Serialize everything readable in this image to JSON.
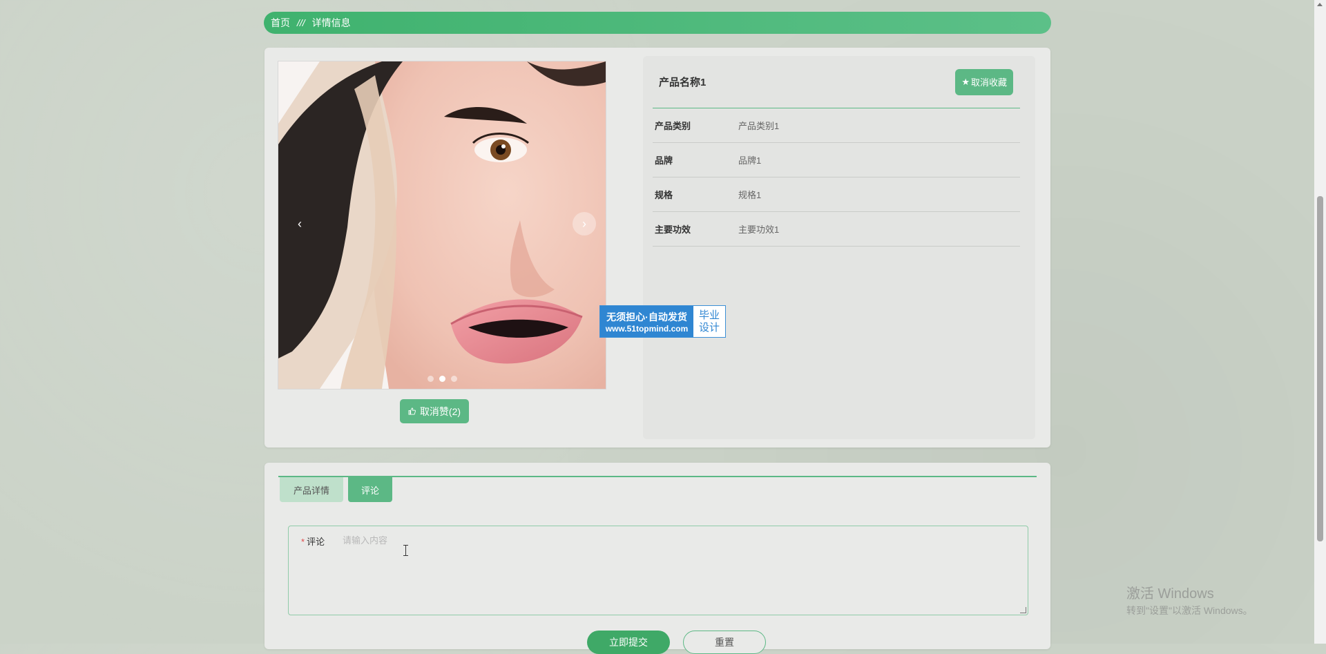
{
  "breadcrumb": {
    "home": "首页",
    "separator": "///",
    "current": "详情信息"
  },
  "product": {
    "name": "产品名称1",
    "favorite_button": "取消收藏",
    "favorite_icon": "star-icon",
    "like_button": "取消赞(2)",
    "like_icon": "thumbs-up-icon",
    "carousel": {
      "slide_count": 3,
      "active_slide": 2
    },
    "attributes": [
      {
        "label": "产品类别",
        "value": "产品类别1"
      },
      {
        "label": "品牌",
        "value": "品牌1"
      },
      {
        "label": "规格",
        "value": "规格1"
      },
      {
        "label": "主要功效",
        "value": "主要功效1"
      }
    ]
  },
  "tabs": [
    {
      "label": "产品详情",
      "active": false
    },
    {
      "label": "评论",
      "active": true
    }
  ],
  "comment_form": {
    "label": "评论",
    "required_mark": "*",
    "placeholder": "请输入内容",
    "value": "",
    "submit_button": "立即提交",
    "reset_button": "重置"
  },
  "ad_banner": {
    "line1": "无须担心·自动发货",
    "line2": "www.51topmind.com",
    "side1": "毕业",
    "side2": "设计"
  },
  "windows_watermark": {
    "title": "激活 Windows",
    "subtitle": "转到\"设置\"以激活 Windows。"
  },
  "colors": {
    "accent": "#5cb885",
    "accent_dark": "#3fa967",
    "background": "#cbd3c8",
    "card": "#e9eae8"
  }
}
